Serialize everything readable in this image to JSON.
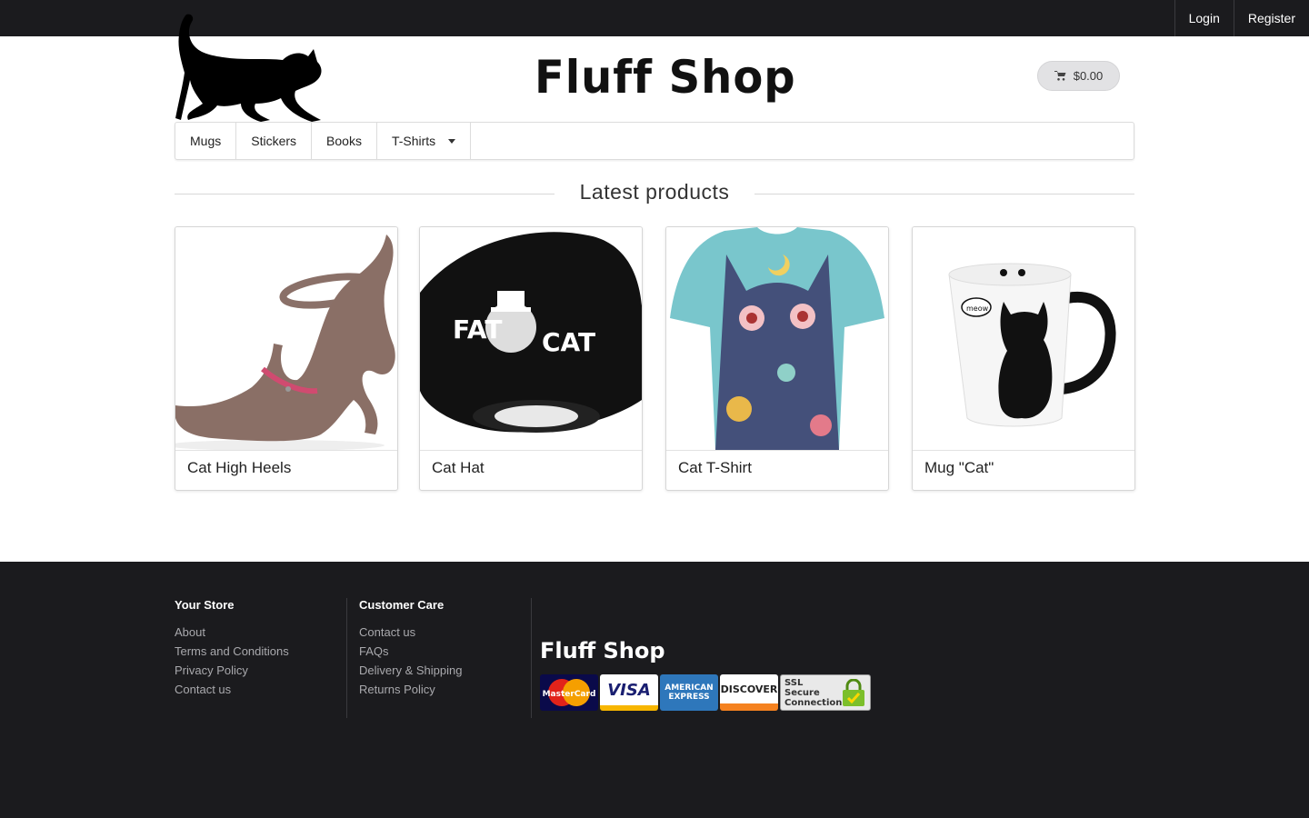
{
  "topbar": {
    "login": "Login",
    "register": "Register"
  },
  "header": {
    "brand": "Fluff Shop",
    "cart_total": "$0.00"
  },
  "nav": {
    "items": [
      "Mugs",
      "Stickers",
      "Books",
      "T-Shirts"
    ]
  },
  "section": {
    "title": "Latest products"
  },
  "products": [
    {
      "name": "Cat High Heels"
    },
    {
      "name": "Cat Hat"
    },
    {
      "name": "Cat T-Shirt"
    },
    {
      "name": "Mug \"Cat\""
    }
  ],
  "product_images": {
    "hat": {
      "left": "FAT",
      "right": "CAT"
    },
    "mug": {
      "bubble": "meow"
    }
  },
  "footer": {
    "your_store": {
      "title": "Your Store",
      "links": [
        "About",
        "Terms and Conditions",
        "Privacy Policy",
        "Contact us"
      ]
    },
    "customer_care": {
      "title": "Customer Care",
      "links": [
        "Contact us",
        "FAQs",
        "Delivery & Shipping",
        "Returns Policy"
      ]
    },
    "brand": "Fluff Shop",
    "payment": {
      "mastercard": "MasterCard",
      "visa": "VISA",
      "amex": "AMERICAN EXPRESS",
      "discover": "DISCOVER",
      "ssl": "SSL Secure Connection"
    }
  },
  "colors": {
    "dark": "#1b1b1e",
    "cart_bg": "#e2e2e4",
    "footer_link": "#a9a9ad"
  }
}
